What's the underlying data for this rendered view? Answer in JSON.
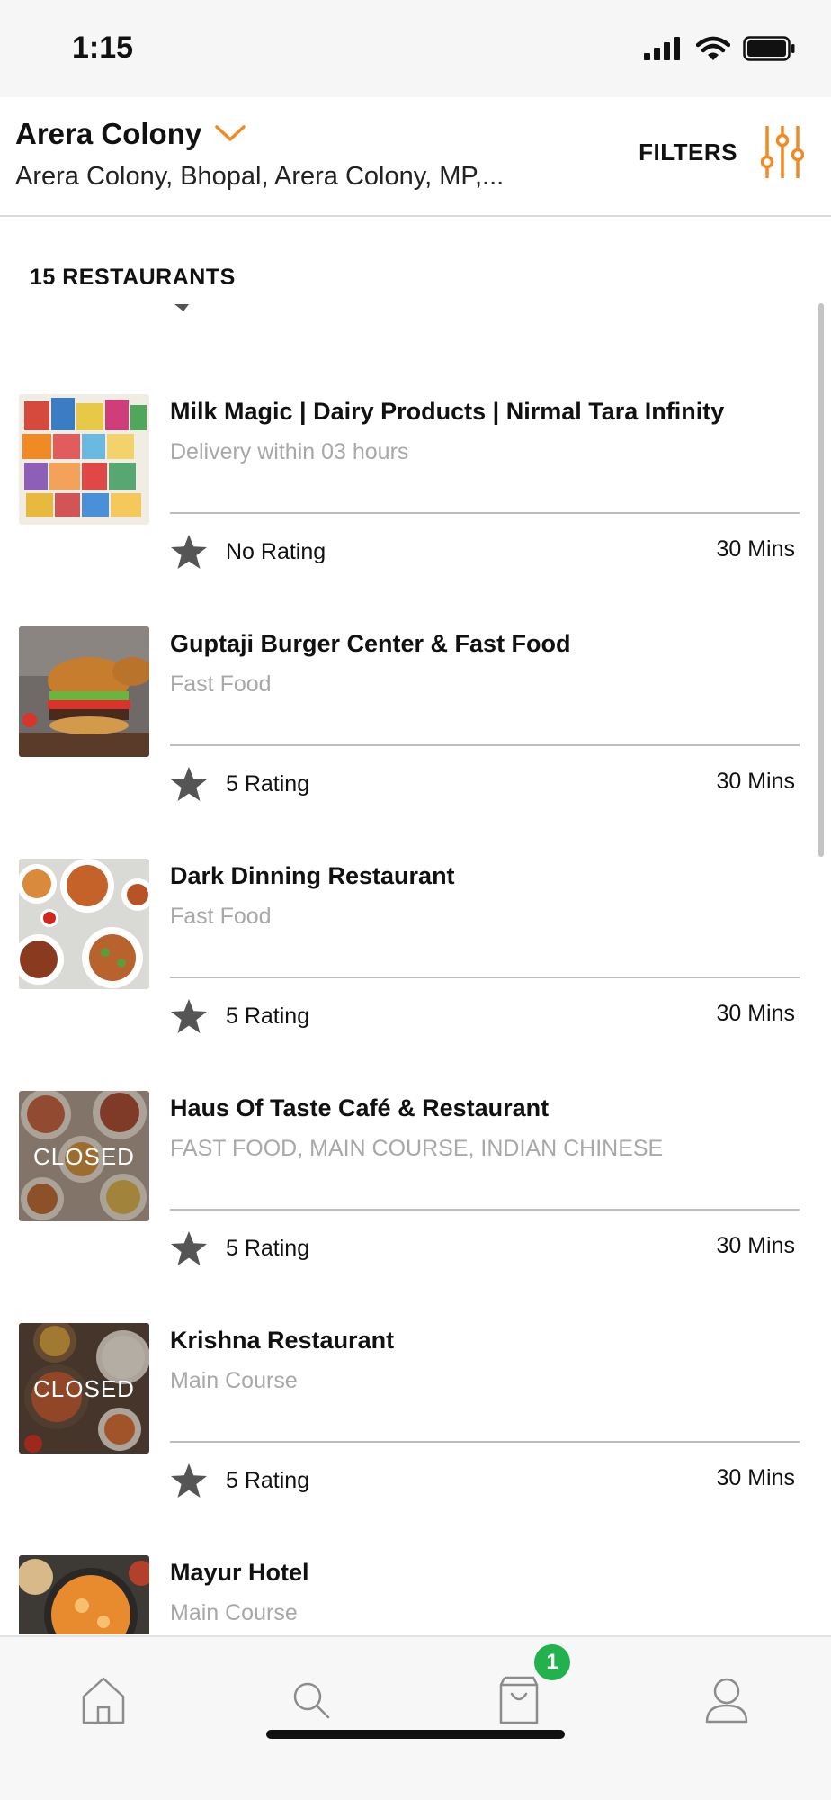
{
  "status_bar": {
    "time": "1:15"
  },
  "header": {
    "location_title": "Arera Colony",
    "location_address": "Arera Colony, Bhopal, Arera Colony, MP,...",
    "filters_label": "FILTERS",
    "accent_color": "#f08a24"
  },
  "restaurant_count_label": "15 RESTAURANTS",
  "restaurants": [
    {
      "name": "Milk Magic | Dairy Products | Nirmal Tara Infinity",
      "category": "Delivery within 03 hours",
      "rating": "No Rating",
      "time": "30 Mins",
      "closed": false,
      "image": "dairy-products-image"
    },
    {
      "name": "Guptaji Burger Center & Fast Food",
      "category": "Fast Food",
      "rating": "5 Rating",
      "time": "30 Mins",
      "closed": false,
      "image": "burger-image"
    },
    {
      "name": "Dark Dinning Restaurant",
      "category": "Fast Food",
      "rating": "5 Rating",
      "time": "30 Mins",
      "closed": false,
      "image": "food-platter-image"
    },
    {
      "name": "Haus Of Taste Café & Restaurant",
      "category": "FAST FOOD, MAIN COURSE, INDIAN CHINESE",
      "rating": "5 Rating",
      "time": "30 Mins",
      "closed": true,
      "closed_label": "CLOSED",
      "image": "indian-dishes-image"
    },
    {
      "name": "Krishna Restaurant",
      "category": "Main Course",
      "rating": "5 Rating",
      "time": "30 Mins",
      "closed": true,
      "closed_label": "CLOSED",
      "image": "curry-rice-image"
    },
    {
      "name": "Mayur Hotel",
      "category": "Main Course",
      "rating": "",
      "time": "",
      "closed": false,
      "image": "curry-bowl-image"
    }
  ],
  "bottom_nav": {
    "items": [
      "home-icon",
      "search-icon",
      "cart-icon",
      "profile-icon"
    ],
    "cart_badge": "1",
    "badge_color": "#22b14c"
  }
}
